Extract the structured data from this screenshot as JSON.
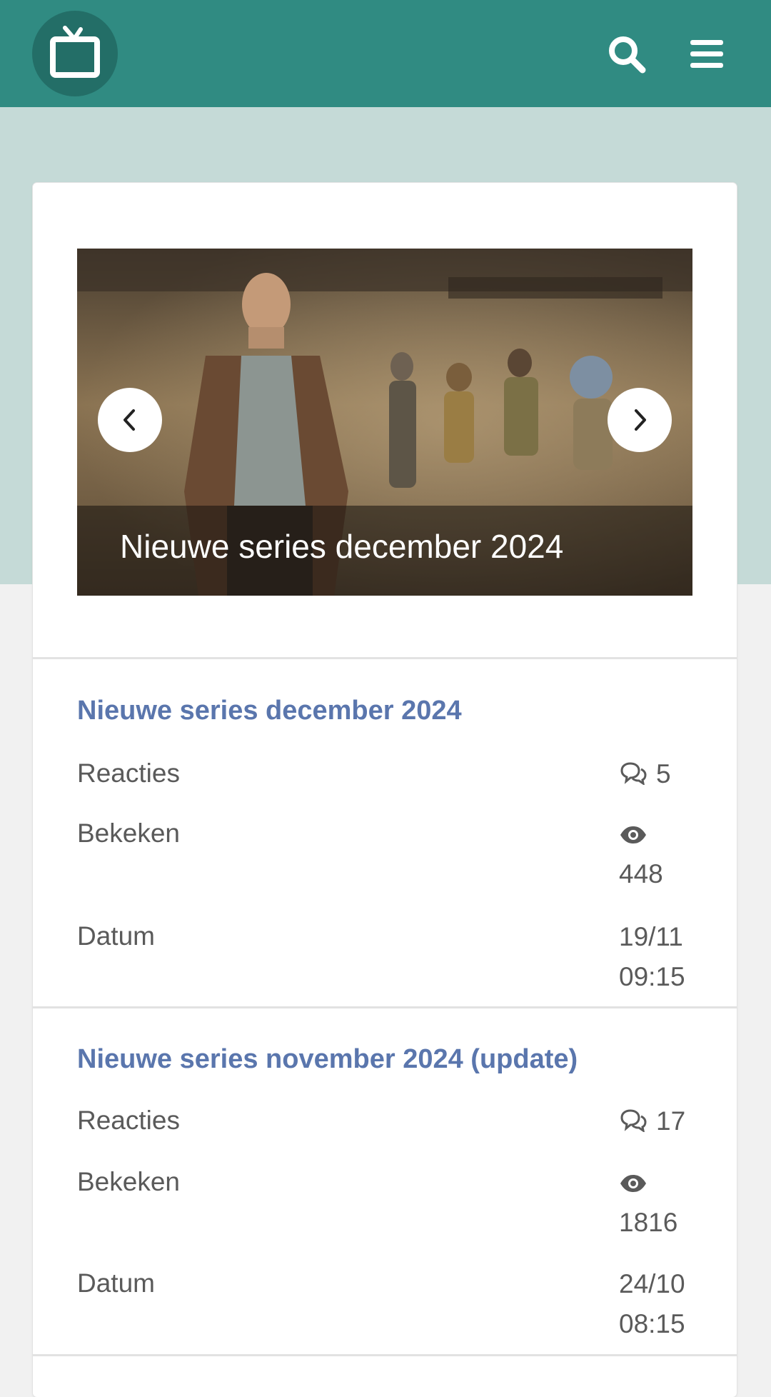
{
  "header": {
    "logo_icon": "tv-icon",
    "search_icon": "search-icon",
    "menu_icon": "hamburger-menu-icon",
    "background_color": "#308b82"
  },
  "slider": {
    "caption": "Nieuwe series december 2024",
    "prev_icon": "chevron-left-icon",
    "next_icon": "chevron-right-icon"
  },
  "posts": [
    {
      "title": "Nieuwe series december 2024",
      "reactions_label": "Reacties",
      "reactions_value": "5",
      "views_label": "Bekeken",
      "views_value": "448",
      "date_label": "Datum",
      "date_day": "19/11",
      "date_time": "09:15"
    },
    {
      "title": "Nieuwe series november 2024 (update)",
      "reactions_label": "Reacties",
      "reactions_value": "17",
      "views_label": "Bekeken",
      "views_value": "1816",
      "date_label": "Datum",
      "date_day": "24/10",
      "date_time": "08:15"
    }
  ],
  "colors": {
    "accent": "#308b82",
    "link": "#5a76ad",
    "hero_background": "#c5dad7"
  }
}
